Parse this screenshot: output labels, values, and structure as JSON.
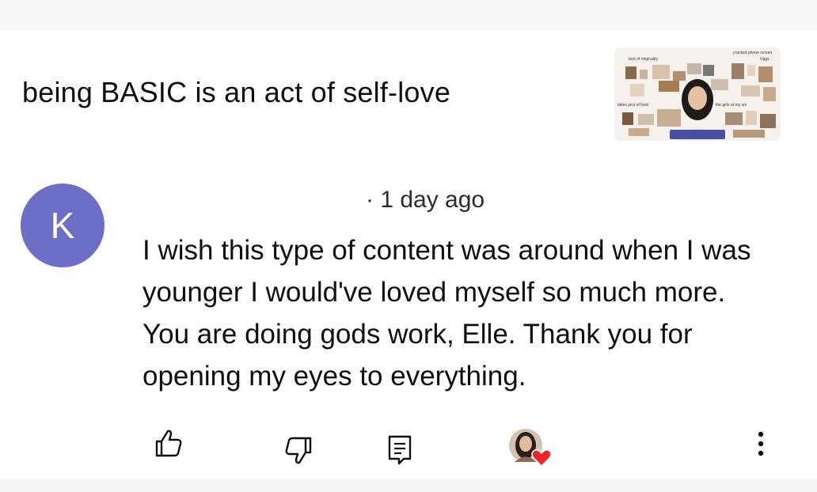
{
  "video": {
    "title": "being BASIC is an act of self-love",
    "thumbnail_captions": [
      "lack of originality",
      "cracked phone screen",
      "Uggs",
      "takes pics of food",
      "the girls at my uni"
    ]
  },
  "comment": {
    "author_initial": "K",
    "avatar_color": "#6d6fc7",
    "timestamp": "· 1 day ago",
    "text": "I wish this type of content was around when I was younger I would've loved myself so much more. You are doing gods work, Elle. Thank you for opening my eyes to everything."
  },
  "actions": {
    "like_icon": "thumbs-up-icon",
    "dislike_icon": "thumbs-down-icon",
    "reply_icon": "reply-icon",
    "creator_heart_icon": "creator-heart-icon",
    "more_icon": "more-vertical-icon"
  },
  "colors": {
    "heart": "#e8262b"
  }
}
